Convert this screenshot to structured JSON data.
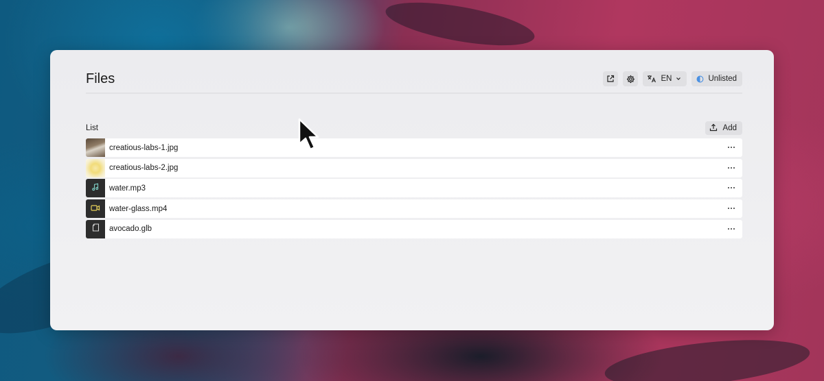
{
  "page": {
    "title": "Files"
  },
  "toolbar": {
    "open_external_icon": "external-link-icon",
    "settings_icon": "gear-icon",
    "language_icon": "translate-icon",
    "language_label": "EN",
    "visibility_icon": "half-circle-icon",
    "visibility_label": "Unlisted"
  },
  "list": {
    "title": "List",
    "add_label": "Add",
    "add_icon": "upload-icon",
    "files": [
      {
        "name": "creatious-labs-1.jpg",
        "thumb": "image-preview"
      },
      {
        "name": "creatious-labs-2.jpg",
        "thumb": "image-preview"
      },
      {
        "name": "water.mp3",
        "thumb": "music-note-icon"
      },
      {
        "name": "water-glass.mp4",
        "thumb": "video-icon"
      },
      {
        "name": "avocado.glb",
        "thumb": "file-icon"
      }
    ]
  },
  "colors": {
    "audio_icon": "#7fd1c7",
    "video_icon": "#e8d25a",
    "status_icon": "#4a90e2"
  }
}
